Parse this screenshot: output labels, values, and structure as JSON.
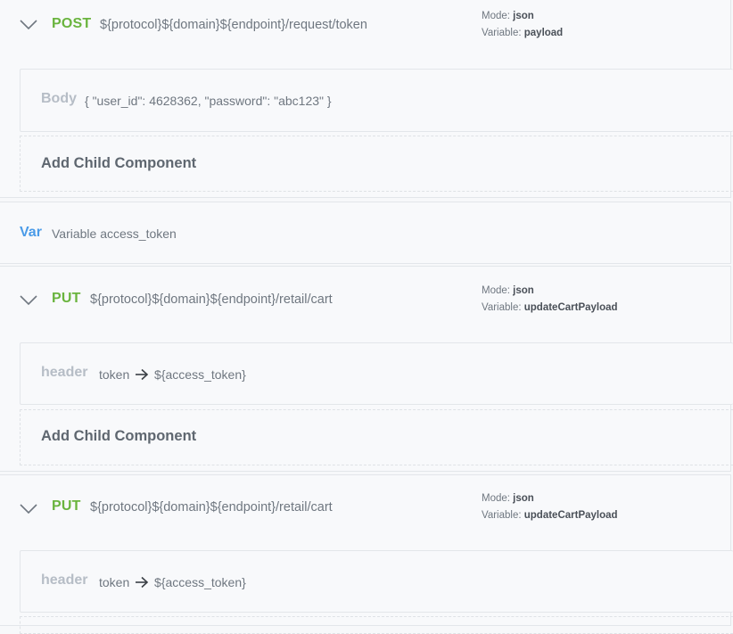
{
  "requests": [
    {
      "method": "POST",
      "url": "${protocol}${domain}${endpoint}/request/token",
      "mode_label": "Mode:",
      "mode": "json",
      "variable_label": "Variable:",
      "variable": "payload",
      "child": {
        "label": "Body",
        "text": "{ \"user_id\": 4628362, \"password\": \"abc123\" }"
      },
      "add_label": "Add Child Component"
    },
    {
      "method": "PUT",
      "url": "${protocol}${domain}${endpoint}/retail/cart",
      "mode_label": "Mode:",
      "mode": "json",
      "variable_label": "Variable:",
      "variable": "updateCartPayload",
      "child": {
        "label": "header",
        "key": "token",
        "value": "${access_token}"
      },
      "add_label": "Add Child Component"
    },
    {
      "method": "PUT",
      "url": "${protocol}${domain}${endpoint}/retail/cart",
      "mode_label": "Mode:",
      "mode": "json",
      "variable_label": "Variable:",
      "variable": "updateCartPayload",
      "child": {
        "label": "header",
        "key": "token",
        "value": "${access_token}"
      }
    }
  ],
  "var_block": {
    "keyword": "Var",
    "text": "Variable access_token"
  },
  "icons": {
    "collapse": "chevron-down-icon",
    "arrow": "arrow-right-icon"
  },
  "colors": {
    "method": "#6ab43e",
    "var": "#4a9be8",
    "placeholder": "#b6bdc6"
  }
}
